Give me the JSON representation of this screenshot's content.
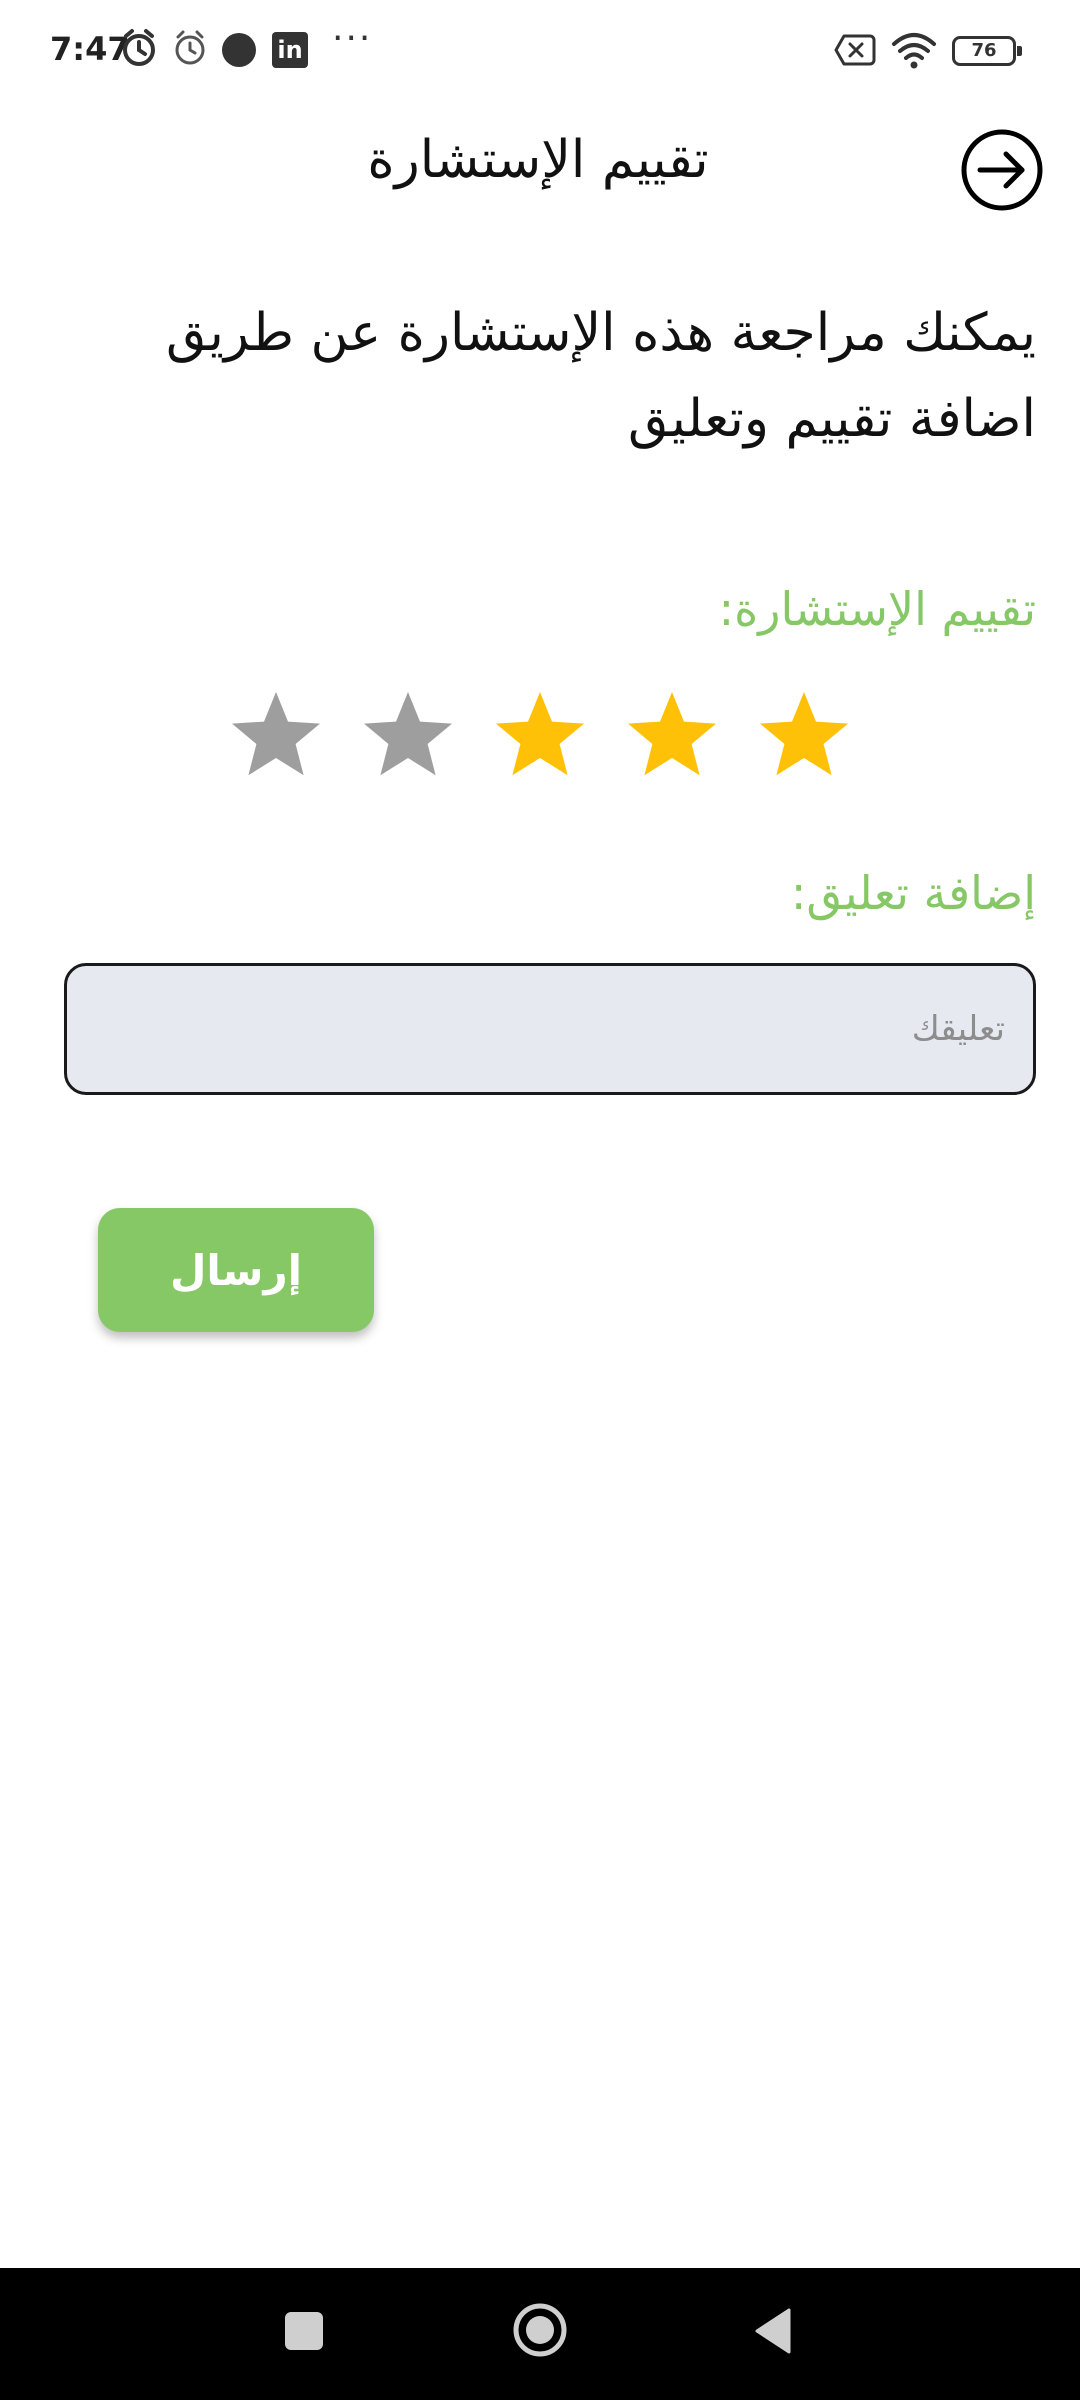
{
  "status_bar": {
    "time": "7:47",
    "linkedin_label": "in",
    "more_label": "···",
    "battery_level": "76"
  },
  "header": {
    "title": "تقييم الإستشارة",
    "back_icon": "arrow-right-circle-icon"
  },
  "description": "يمكنك مراجعة هذه الإستشارة عن طريق اضافة تقييم وتعليق",
  "rating": {
    "label": "تقييم الإستشارة:",
    "value": 3,
    "max": 5,
    "filled_color": "#FFC107",
    "empty_color": "#9E9E9E"
  },
  "comment": {
    "label": "إضافة تعليق:",
    "placeholder": "تعليقك",
    "value": ""
  },
  "submit": {
    "label": "إرسال",
    "color": "#86C766"
  },
  "colors": {
    "accent": "#86C766",
    "input_bg": "#E7E9F1"
  },
  "nav_bar": {
    "recents_icon": "square-icon",
    "home_icon": "circle-home-icon",
    "back_icon": "triangle-back-icon"
  }
}
